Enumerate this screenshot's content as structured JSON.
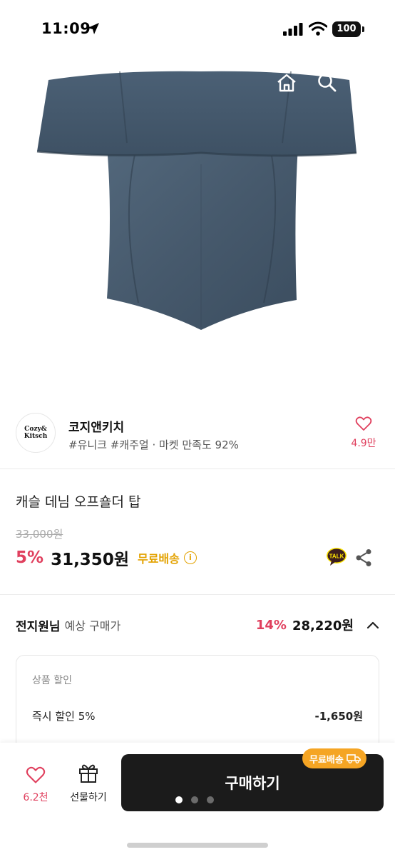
{
  "status_bar": {
    "time": "11:09",
    "battery": "100"
  },
  "shop": {
    "logo_line1": "Cozy&",
    "logo_line2": "Kitsch",
    "name": "코지앤키치",
    "tags": "#유니크 #캐주얼 · 마켓 만족도 92%",
    "like_count": "4.9만"
  },
  "product": {
    "title": "캐슬 데님 오프숄더 탑",
    "original_price": "33,000원",
    "discount_rate": "5%",
    "sale_price": "31,350원",
    "shipping": "무료배송",
    "info_icon": "i",
    "talk_label": "TALK"
  },
  "expected": {
    "user_name": "전지원님",
    "label": "예상 구매가",
    "rate": "14%",
    "price": "28,220원"
  },
  "discount_box": {
    "title": "상품 할인",
    "rows": [
      {
        "label": "즉시 할인 5%",
        "amount": "-1,650원"
      }
    ]
  },
  "bottom_bar": {
    "wish_count": "6.2천",
    "gift_label": "선물하기",
    "buy_label": "구매하기",
    "ship_badge": "무료배송"
  },
  "colors": {
    "accent_pink": "#e0405e",
    "shipping_yellow": "#e3a200",
    "badge_orange": "#f5a524",
    "buy_button": "#1b1b1b",
    "denim": "#4a5e72"
  },
  "icons": [
    "close-icon",
    "home-icon",
    "search-icon",
    "cart-icon",
    "heart-icon",
    "info-icon",
    "kakao-talk-icon",
    "share-icon",
    "chevron-up-icon",
    "gift-icon",
    "truck-icon"
  ]
}
